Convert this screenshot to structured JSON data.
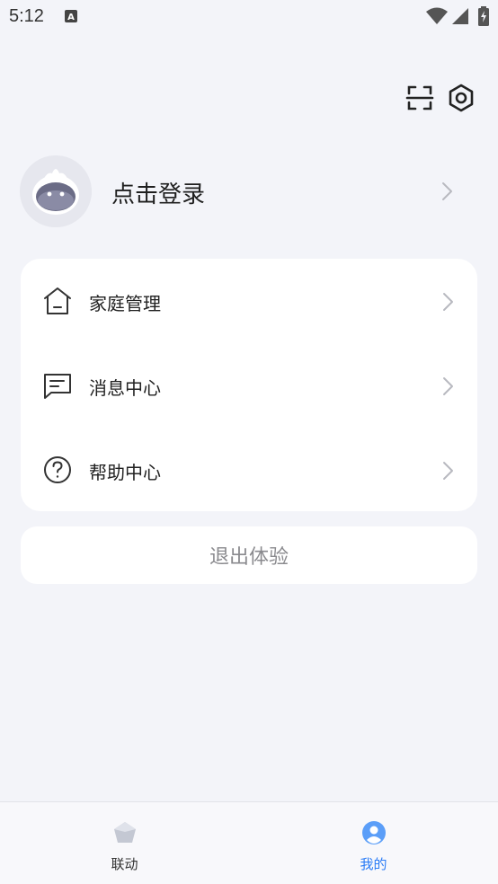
{
  "status_bar": {
    "time": "5:12",
    "icons": [
      "text-a-icon",
      "wifi-icon",
      "cell-signal-icon",
      "battery-charging-icon"
    ]
  },
  "header": {
    "icons": [
      "scan-icon",
      "settings-icon"
    ]
  },
  "profile": {
    "login_text": "点击登录",
    "avatar_icon": "robot-avatar-icon"
  },
  "menu": {
    "items": [
      {
        "label": "家庭管理",
        "icon": "home-icon"
      },
      {
        "label": "消息中心",
        "icon": "message-icon"
      },
      {
        "label": "帮助中心",
        "icon": "help-icon"
      }
    ]
  },
  "exit_button": {
    "label": "退出体验"
  },
  "bottom_nav": {
    "items": [
      {
        "label": "联动",
        "icon": "pentagon-icon",
        "active": false
      },
      {
        "label": "我的",
        "icon": "user-icon",
        "active": true
      }
    ]
  },
  "colors": {
    "background": "#f3f4f9",
    "card": "#ffffff",
    "accent": "#2b7cf6",
    "inactive_nav": "#333333",
    "exit_text": "#8a8a8e"
  }
}
